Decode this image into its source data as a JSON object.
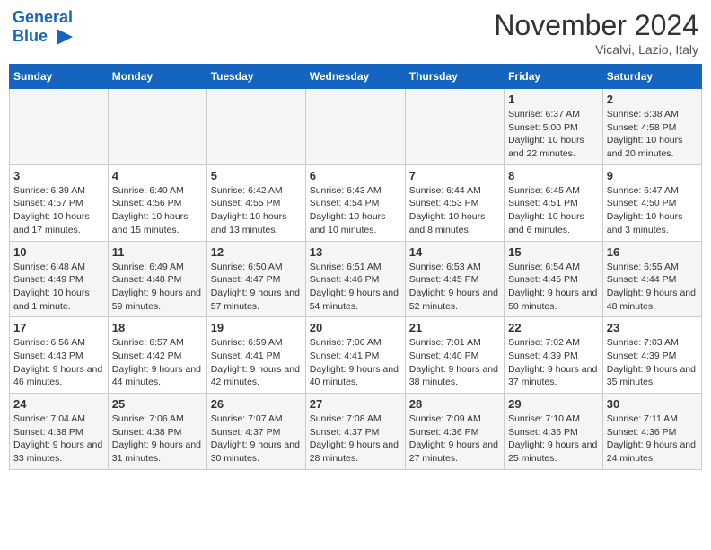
{
  "header": {
    "logo_line1": "General",
    "logo_line2": "Blue",
    "month": "November 2024",
    "location": "Vicalvi, Lazio, Italy"
  },
  "weekdays": [
    "Sunday",
    "Monday",
    "Tuesday",
    "Wednesday",
    "Thursday",
    "Friday",
    "Saturday"
  ],
  "weeks": [
    [
      {
        "day": "",
        "info": ""
      },
      {
        "day": "",
        "info": ""
      },
      {
        "day": "",
        "info": ""
      },
      {
        "day": "",
        "info": ""
      },
      {
        "day": "",
        "info": ""
      },
      {
        "day": "1",
        "info": "Sunrise: 6:37 AM\nSunset: 5:00 PM\nDaylight: 10 hours and 22 minutes."
      },
      {
        "day": "2",
        "info": "Sunrise: 6:38 AM\nSunset: 4:58 PM\nDaylight: 10 hours and 20 minutes."
      }
    ],
    [
      {
        "day": "3",
        "info": "Sunrise: 6:39 AM\nSunset: 4:57 PM\nDaylight: 10 hours and 17 minutes."
      },
      {
        "day": "4",
        "info": "Sunrise: 6:40 AM\nSunset: 4:56 PM\nDaylight: 10 hours and 15 minutes."
      },
      {
        "day": "5",
        "info": "Sunrise: 6:42 AM\nSunset: 4:55 PM\nDaylight: 10 hours and 13 minutes."
      },
      {
        "day": "6",
        "info": "Sunrise: 6:43 AM\nSunset: 4:54 PM\nDaylight: 10 hours and 10 minutes."
      },
      {
        "day": "7",
        "info": "Sunrise: 6:44 AM\nSunset: 4:53 PM\nDaylight: 10 hours and 8 minutes."
      },
      {
        "day": "8",
        "info": "Sunrise: 6:45 AM\nSunset: 4:51 PM\nDaylight: 10 hours and 6 minutes."
      },
      {
        "day": "9",
        "info": "Sunrise: 6:47 AM\nSunset: 4:50 PM\nDaylight: 10 hours and 3 minutes."
      }
    ],
    [
      {
        "day": "10",
        "info": "Sunrise: 6:48 AM\nSunset: 4:49 PM\nDaylight: 10 hours and 1 minute."
      },
      {
        "day": "11",
        "info": "Sunrise: 6:49 AM\nSunset: 4:48 PM\nDaylight: 9 hours and 59 minutes."
      },
      {
        "day": "12",
        "info": "Sunrise: 6:50 AM\nSunset: 4:47 PM\nDaylight: 9 hours and 57 minutes."
      },
      {
        "day": "13",
        "info": "Sunrise: 6:51 AM\nSunset: 4:46 PM\nDaylight: 9 hours and 54 minutes."
      },
      {
        "day": "14",
        "info": "Sunrise: 6:53 AM\nSunset: 4:45 PM\nDaylight: 9 hours and 52 minutes."
      },
      {
        "day": "15",
        "info": "Sunrise: 6:54 AM\nSunset: 4:45 PM\nDaylight: 9 hours and 50 minutes."
      },
      {
        "day": "16",
        "info": "Sunrise: 6:55 AM\nSunset: 4:44 PM\nDaylight: 9 hours and 48 minutes."
      }
    ],
    [
      {
        "day": "17",
        "info": "Sunrise: 6:56 AM\nSunset: 4:43 PM\nDaylight: 9 hours and 46 minutes."
      },
      {
        "day": "18",
        "info": "Sunrise: 6:57 AM\nSunset: 4:42 PM\nDaylight: 9 hours and 44 minutes."
      },
      {
        "day": "19",
        "info": "Sunrise: 6:59 AM\nSunset: 4:41 PM\nDaylight: 9 hours and 42 minutes."
      },
      {
        "day": "20",
        "info": "Sunrise: 7:00 AM\nSunset: 4:41 PM\nDaylight: 9 hours and 40 minutes."
      },
      {
        "day": "21",
        "info": "Sunrise: 7:01 AM\nSunset: 4:40 PM\nDaylight: 9 hours and 38 minutes."
      },
      {
        "day": "22",
        "info": "Sunrise: 7:02 AM\nSunset: 4:39 PM\nDaylight: 9 hours and 37 minutes."
      },
      {
        "day": "23",
        "info": "Sunrise: 7:03 AM\nSunset: 4:39 PM\nDaylight: 9 hours and 35 minutes."
      }
    ],
    [
      {
        "day": "24",
        "info": "Sunrise: 7:04 AM\nSunset: 4:38 PM\nDaylight: 9 hours and 33 minutes."
      },
      {
        "day": "25",
        "info": "Sunrise: 7:06 AM\nSunset: 4:38 PM\nDaylight: 9 hours and 31 minutes."
      },
      {
        "day": "26",
        "info": "Sunrise: 7:07 AM\nSunset: 4:37 PM\nDaylight: 9 hours and 30 minutes."
      },
      {
        "day": "27",
        "info": "Sunrise: 7:08 AM\nSunset: 4:37 PM\nDaylight: 9 hours and 28 minutes."
      },
      {
        "day": "28",
        "info": "Sunrise: 7:09 AM\nSunset: 4:36 PM\nDaylight: 9 hours and 27 minutes."
      },
      {
        "day": "29",
        "info": "Sunrise: 7:10 AM\nSunset: 4:36 PM\nDaylight: 9 hours and 25 minutes."
      },
      {
        "day": "30",
        "info": "Sunrise: 7:11 AM\nSunset: 4:36 PM\nDaylight: 9 hours and 24 minutes."
      }
    ]
  ]
}
